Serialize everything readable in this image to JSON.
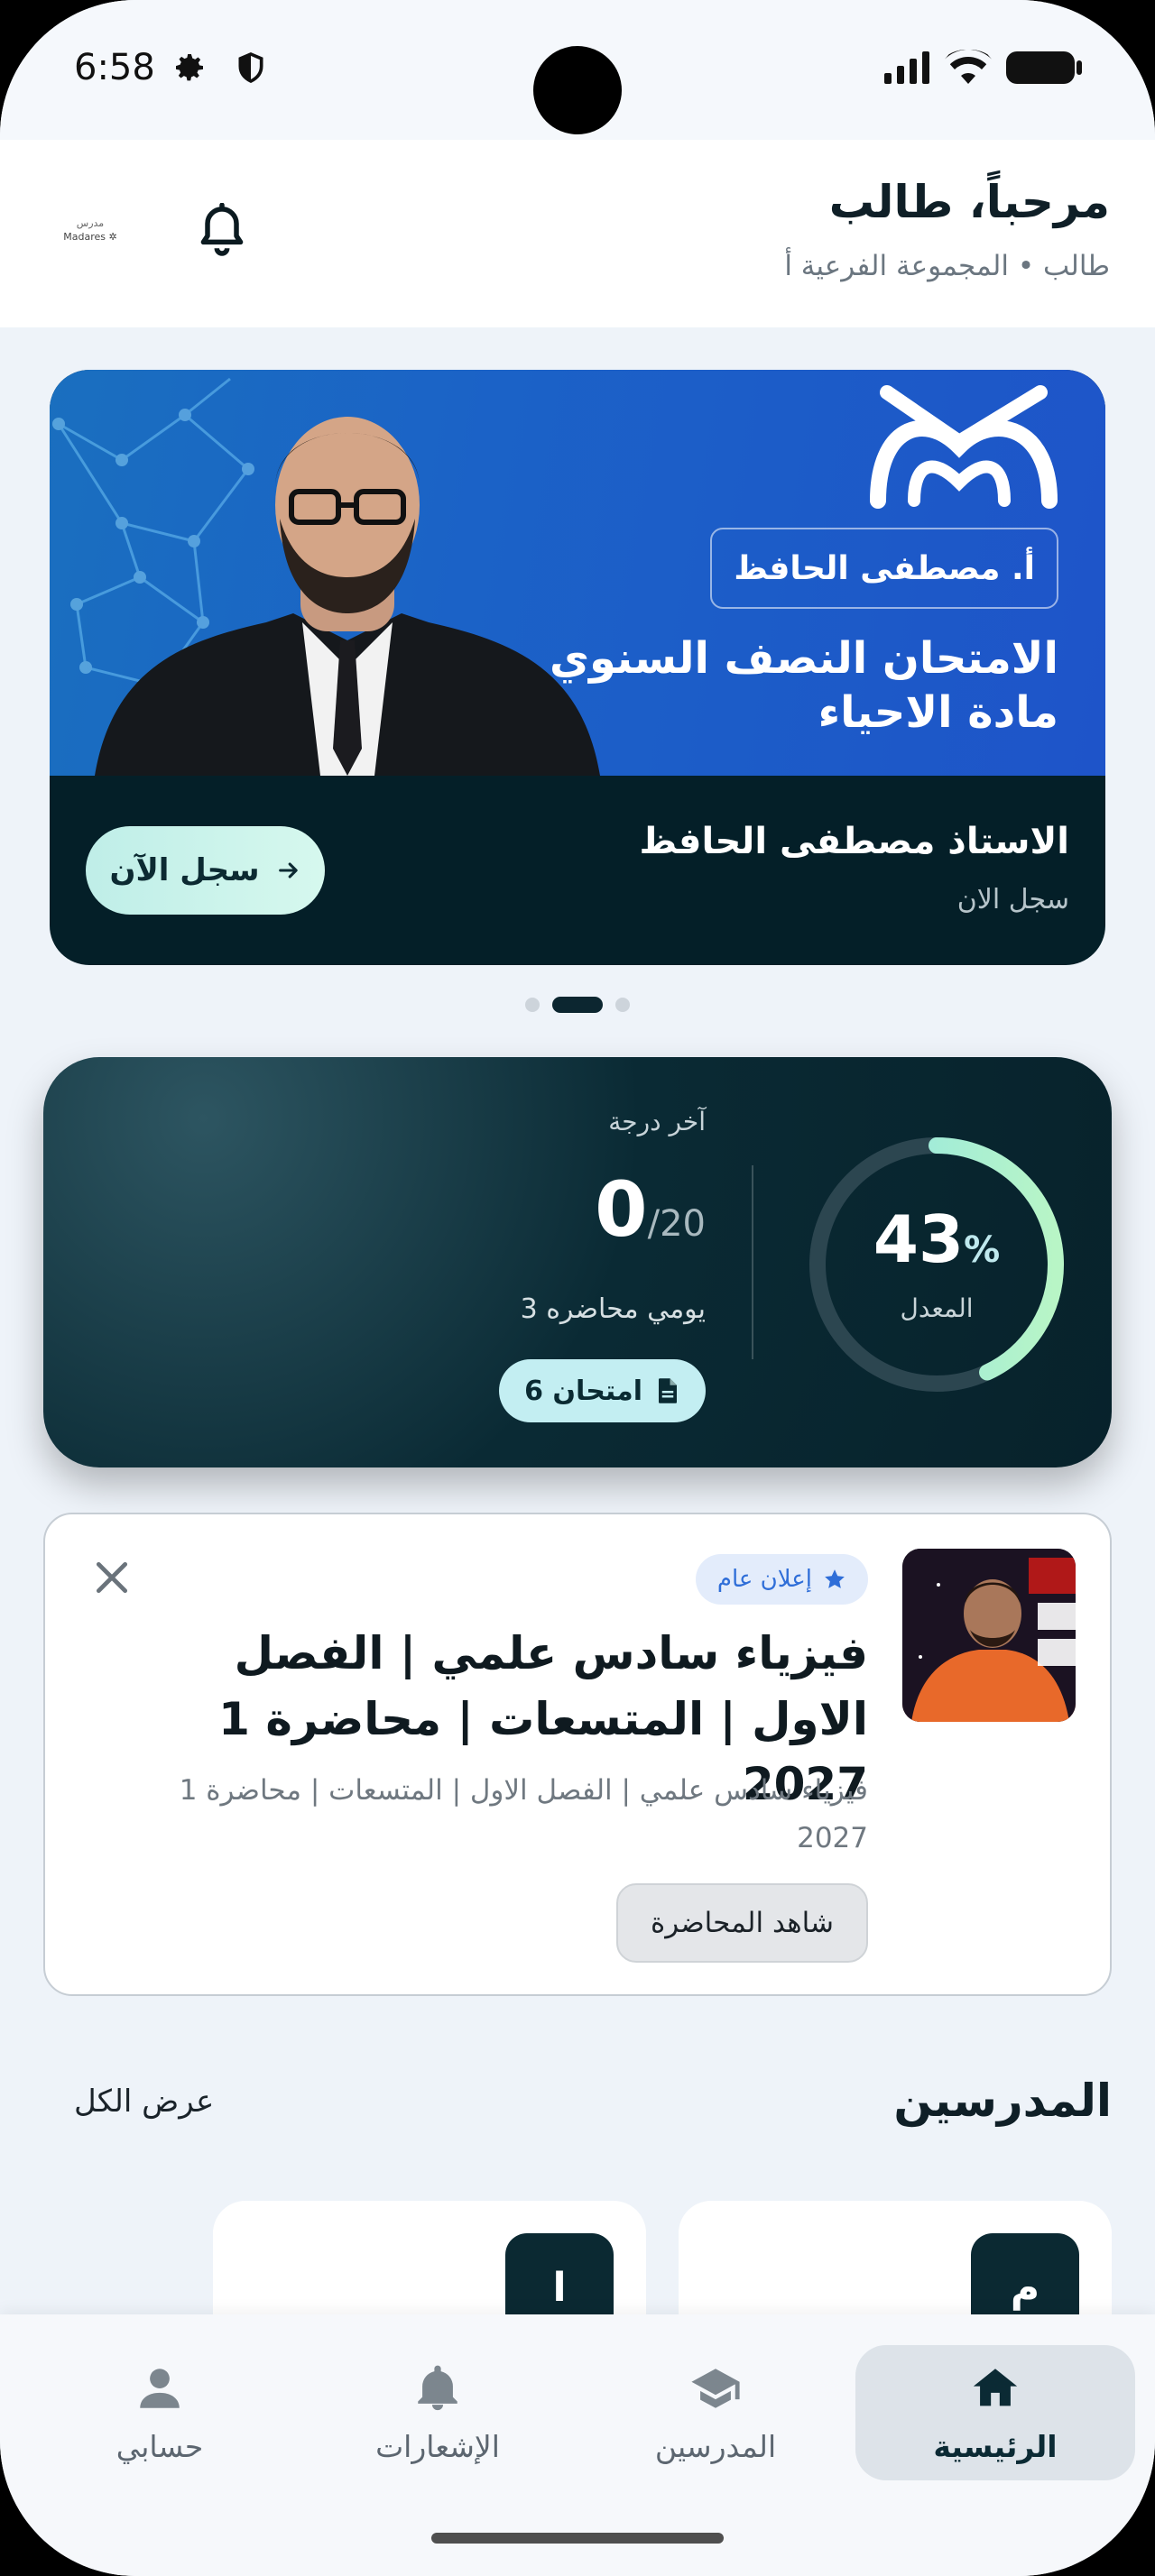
{
  "status_bar": {
    "time": "6:58"
  },
  "header": {
    "greeting": "مرحباً، طالب",
    "subtitle": "طالب • المجموعة الفرعية أ"
  },
  "banner": {
    "teacher_badge": "أ. مصطفى الحافظ",
    "title_line1": "الامتحان النصف السنوي",
    "title_line2": "مادة الاحياء",
    "name": "الاستاذ مصطفى الحافظ",
    "subtitle": "سجل الان",
    "register_label": "سجل الآن",
    "page_count": 3,
    "active_page": 2
  },
  "stats": {
    "average_value": "43",
    "average_unit": "%",
    "average_fraction": 0.43,
    "average_label": "المعدل",
    "last_grade_label": "آخر درجة",
    "last_grade_score": "0",
    "last_grade_total": "/20",
    "last_lecture": "يومي محاضره 3",
    "exams_label": "6 امتحان"
  },
  "announcement": {
    "chip": "إعلان عام",
    "title": "فيزياء سادس علمي | الفصل الاول | المتسعات | محاضرة 1 2027",
    "description": "فيزياء سادس علمي | الفصل الاول | المتسعات | محاضرة 1 2027",
    "watch_label": "شاهد المحاضرة"
  },
  "teachers": {
    "title": "المدرسين",
    "view_all": "عرض الكل",
    "cards": [
      {
        "initial": "م"
      },
      {
        "initial": "ا"
      }
    ]
  },
  "nav": {
    "items": [
      {
        "label": "الرئيسية",
        "icon": "home-icon",
        "active": true
      },
      {
        "label": "المدرسين",
        "icon": "graduation-cap-icon",
        "active": false
      },
      {
        "label": "الإشعارات",
        "icon": "bell-icon",
        "active": false
      },
      {
        "label": "حسابي",
        "icon": "person-icon",
        "active": false
      }
    ]
  },
  "colors": {
    "primary_dark": "#0b2a34",
    "accent_mint": "#bfeee8",
    "chip_blue": "#2f6ed8"
  }
}
